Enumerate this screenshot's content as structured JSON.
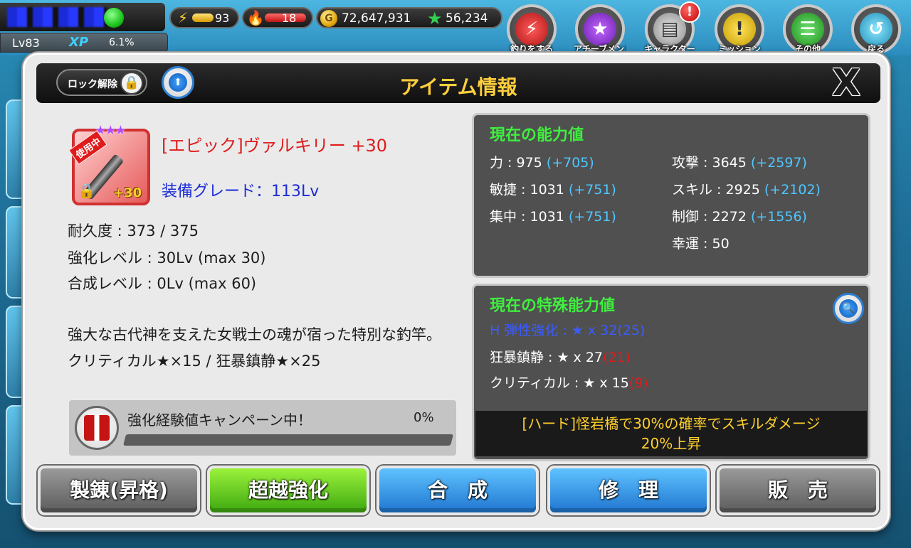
{
  "hud": {
    "level": "Lv83",
    "xp_label": "XP",
    "xp_percent": "6.1%",
    "energy": "93",
    "fire": "18",
    "gold": "72,647,931",
    "stars": "56,234",
    "menu": [
      {
        "label": "釣りをする",
        "icon": "lightning-icon"
      },
      {
        "label": "アチーブメント",
        "icon": "star-icon"
      },
      {
        "label": "キャラクター",
        "icon": "id-card-icon"
      },
      {
        "label": "ミッション",
        "icon": "lightbulb-icon"
      },
      {
        "label": "その他",
        "icon": "list-icon"
      },
      {
        "label": "戻る",
        "icon": "return-icon"
      }
    ],
    "alert_badge": "!"
  },
  "dialog": {
    "title": "アイテム情報",
    "unlock_label": "ロック解除",
    "close_label": "X"
  },
  "item": {
    "in_use_badge": "使用中",
    "plus_badge": "+30",
    "stars": "★★★",
    "name": "[エピック]ヴァルキリー +30",
    "grade": "装備グレード：113Lv",
    "durability": "耐久度 : 373 / 375",
    "enhance_level": "強化レベル : 30Lv (max 30)",
    "synth_level": "合成レベル : 0Lv (max 60)",
    "description": "強大な古代神を支えた女戦士の魂が宿った特別な釣竿。 クリティカル★×15 / 狂暴鎮静★×25"
  },
  "campaign": {
    "text": "強化経験値キャンペーン中！",
    "percent": "0%",
    "progress": 0
  },
  "stats": {
    "title": "現在の能力値",
    "left": [
      {
        "label": "力 : 975 ",
        "bonus": "(+705)"
      },
      {
        "label": "敏捷 : 1031 ",
        "bonus": "(+751)"
      },
      {
        "label": "集中 : 1031 ",
        "bonus": "(+751)"
      }
    ],
    "right": [
      {
        "label": "攻撃 : 3645 ",
        "bonus": "(+2597)"
      },
      {
        "label": "スキル : 2925 ",
        "bonus": "(+2102)"
      },
      {
        "label": "制御 : 2272 ",
        "bonus": "(+1556)"
      },
      {
        "label": "幸運 : 50",
        "bonus": ""
      }
    ]
  },
  "special": {
    "title": "現在の特殊能力値",
    "abilities": [
      {
        "label": "H 弾性強化 : ★ x 32",
        "level": "(25)"
      },
      {
        "label": "狂暴鎮静 : ★ x 27",
        "level": "(21)"
      },
      {
        "label": "クリティカル : ★ x 15",
        "level": "(9)"
      }
    ],
    "effect": "[ハード]怪岩橋で30%の確率でスキルダメージ\n20%上昇"
  },
  "buttons": {
    "refine": "製錬(昇格)",
    "transcend": "超越強化",
    "synth": "合　成",
    "repair": "修　理",
    "sell": "販　売"
  },
  "colors": {
    "title_gold": "#ffce3d",
    "item_name_red": "#e01b1b",
    "grade_blue": "#1c2cd6",
    "panel_title_green": "#3fef3f",
    "stat_bonus_blue": "#4fc6ff"
  }
}
